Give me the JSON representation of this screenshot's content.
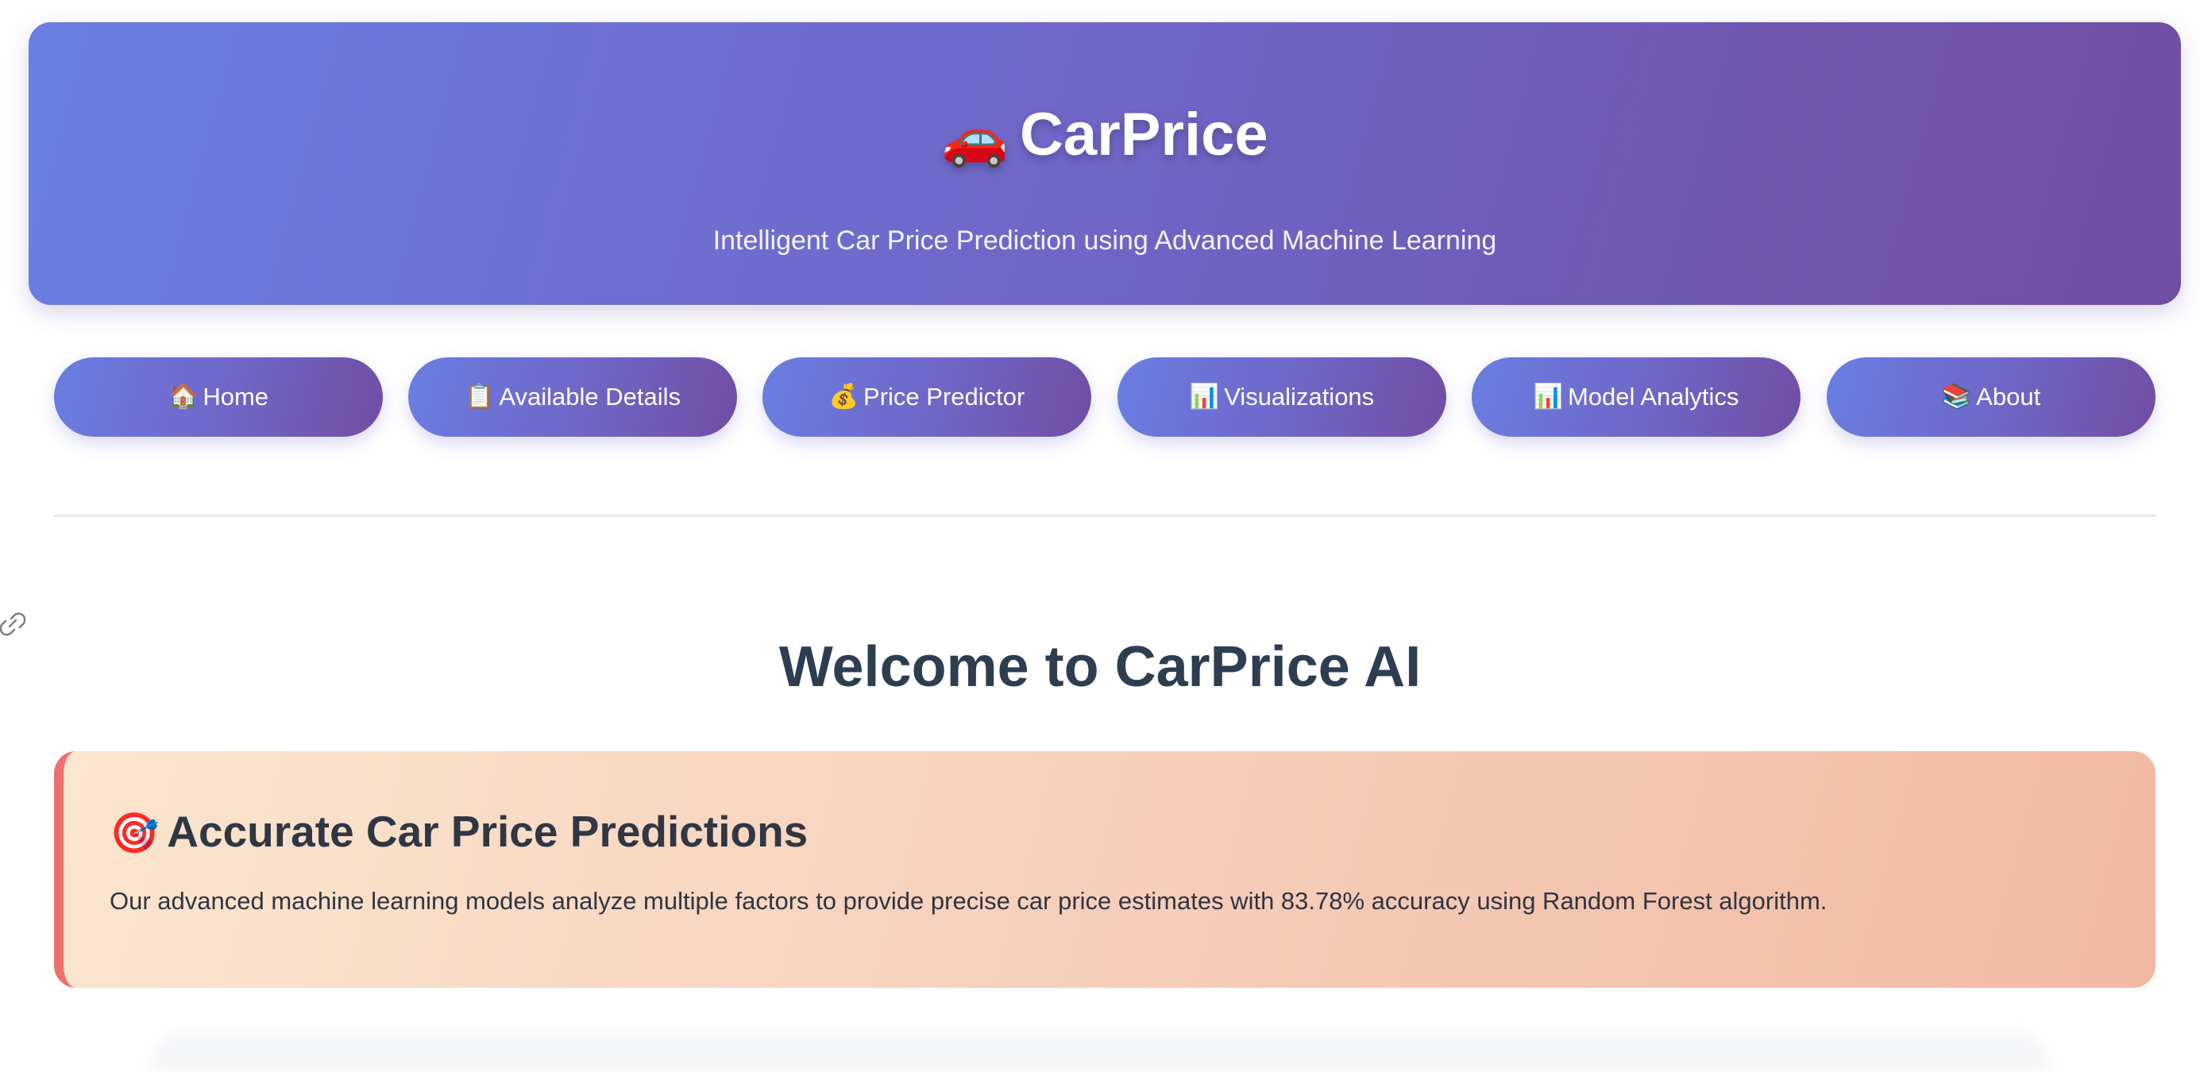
{
  "header": {
    "logo_icon": "🚗",
    "title": "CarPrice",
    "subtitle": "Intelligent Car Price Prediction using Advanced Machine Learning"
  },
  "nav": {
    "buttons": [
      {
        "icon": "🏠",
        "label": "Home"
      },
      {
        "icon": "📋",
        "label": "Available Details"
      },
      {
        "icon": "💰",
        "label": "Price Predictor"
      },
      {
        "icon": "📊",
        "label": "Visualizations"
      },
      {
        "icon": "📊",
        "label": "Model Analytics"
      },
      {
        "icon": "📚",
        "label": "About"
      }
    ]
  },
  "main": {
    "welcome_title": "Welcome to CarPrice AI",
    "feature_card": {
      "icon": "🎯",
      "title": "Accurate Car Price Predictions",
      "description": "Our advanced machine learning models analyze multiple factors to provide precise car price estimates with 83.78% accuracy using Random Forest algorithm."
    }
  },
  "colors": {
    "primary_gradient_start": "#6a7ee2",
    "primary_gradient_end": "#704ea3",
    "feature_gradient_start": "#fbe6cf",
    "feature_gradient_end": "#f2b9a2",
    "feature_accent": "#ee6f6f",
    "heading_text": "#2c3e50"
  }
}
